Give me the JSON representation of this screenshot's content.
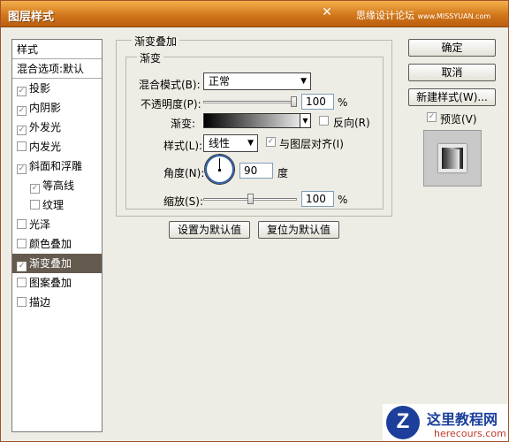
{
  "window": {
    "title": "图层样式",
    "close_glyph": "✕",
    "watermark_top": "思缘设计论坛",
    "watermark_top_url": "www.MISSYUAN.com"
  },
  "style_list": {
    "header": "样式",
    "blend_options": "混合选项:默认",
    "items": [
      {
        "label": "投影",
        "checked": true,
        "indent": false,
        "active": false
      },
      {
        "label": "内阴影",
        "checked": true,
        "indent": false,
        "active": false
      },
      {
        "label": "外发光",
        "checked": true,
        "indent": false,
        "active": false
      },
      {
        "label": "内发光",
        "checked": false,
        "indent": false,
        "active": false
      },
      {
        "label": "斜面和浮雕",
        "checked": true,
        "indent": false,
        "active": false
      },
      {
        "label": "等高线",
        "checked": true,
        "indent": true,
        "active": false
      },
      {
        "label": "纹理",
        "checked": false,
        "indent": true,
        "active": false
      },
      {
        "label": "光泽",
        "checked": false,
        "indent": false,
        "active": false
      },
      {
        "label": "颜色叠加",
        "checked": false,
        "indent": false,
        "active": false
      },
      {
        "label": "渐变叠加",
        "checked": true,
        "indent": false,
        "active": true
      },
      {
        "label": "图案叠加",
        "checked": false,
        "indent": false,
        "active": false
      },
      {
        "label": "描边",
        "checked": false,
        "indent": false,
        "active": false
      }
    ]
  },
  "panel": {
    "group_title": "渐变叠加",
    "subgroup_title": "渐变",
    "blend_mode_label": "混合模式(B):",
    "blend_mode_value": "正常",
    "opacity_label": "不透明度(P):",
    "opacity_value": "100",
    "opacity_unit": "%",
    "gradient_label": "渐变:",
    "reverse_label": "反向(R)",
    "reverse_checked": false,
    "style_label": "样式(L):",
    "style_value": "线性",
    "align_label": "与图层对齐(I)",
    "align_checked": true,
    "angle_label": "角度(N):",
    "angle_value": "90",
    "angle_unit": "度",
    "scale_label": "缩放(S):",
    "scale_value": "100",
    "scale_unit": "%",
    "opacity_level": 1.0,
    "scale_level": 0.5,
    "make_default_button": "设置为默认值",
    "reset_default_button": "复位为默认值"
  },
  "side_buttons": {
    "ok": "确定",
    "cancel": "取消",
    "new_style": "新建样式(W)...",
    "preview_label": "预览(V)",
    "preview_checked": true
  },
  "watermark_bottom": {
    "logo_letter": "Z",
    "title": "这里教程网",
    "url": "herecours.com"
  }
}
